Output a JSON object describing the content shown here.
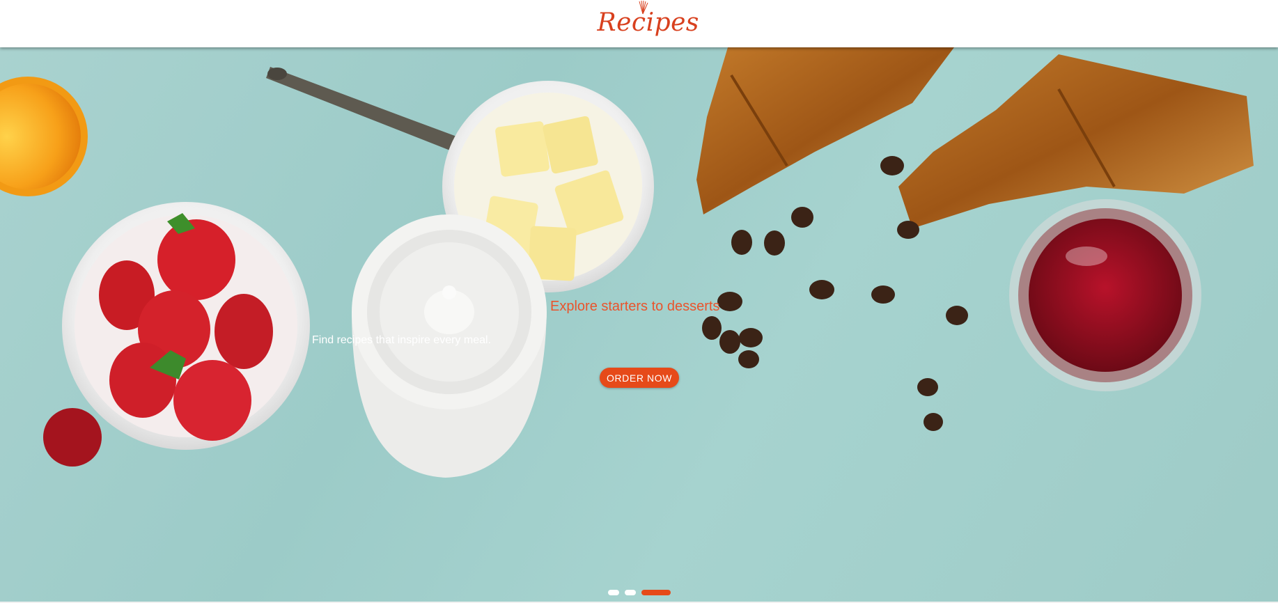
{
  "header": {
    "logo_text": "Recipes",
    "logo_icon": "whisk-icon"
  },
  "hero": {
    "heading": "Explore starters to desserts",
    "subtitle": "Find recipes that inspire every meal.",
    "button_label": "ORDER NOW",
    "slides": [
      {
        "active": false
      },
      {
        "active": false
      },
      {
        "active": true
      }
    ]
  },
  "colors": {
    "accent": "#e64a19",
    "logo": "#d8401e",
    "background": "#a6d3cf"
  }
}
